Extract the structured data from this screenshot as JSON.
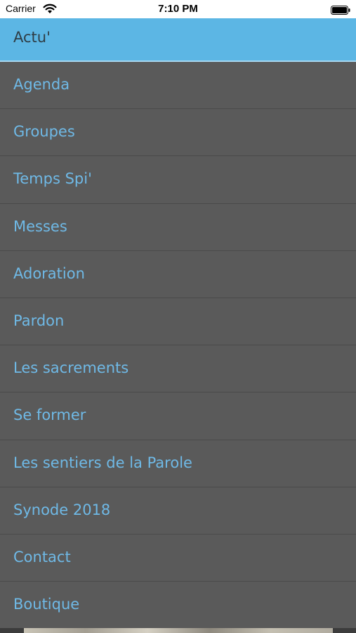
{
  "status_bar": {
    "carrier": "Carrier",
    "time": "7:10 PM",
    "icons": [
      "wifi-icon",
      "battery-icon"
    ]
  },
  "header": {
    "title": "Actu'"
  },
  "menu": {
    "items": [
      {
        "label": "Agenda"
      },
      {
        "label": "Groupes"
      },
      {
        "label": "Temps Spi'"
      },
      {
        "label": "Messes"
      },
      {
        "label": "Adoration"
      },
      {
        "label": "Pardon"
      },
      {
        "label": "Les sacrements"
      },
      {
        "label": "Se former"
      },
      {
        "label": "Les sentiers de la Parole"
      },
      {
        "label": "Synode 2018"
      },
      {
        "label": "Contact"
      },
      {
        "label": "Boutique"
      }
    ]
  },
  "colors": {
    "header_bg": "#5cb6e4",
    "menu_bg": "#5a5a5a",
    "menu_text": "#6fb9e6",
    "divider": "#4a4a4a"
  }
}
